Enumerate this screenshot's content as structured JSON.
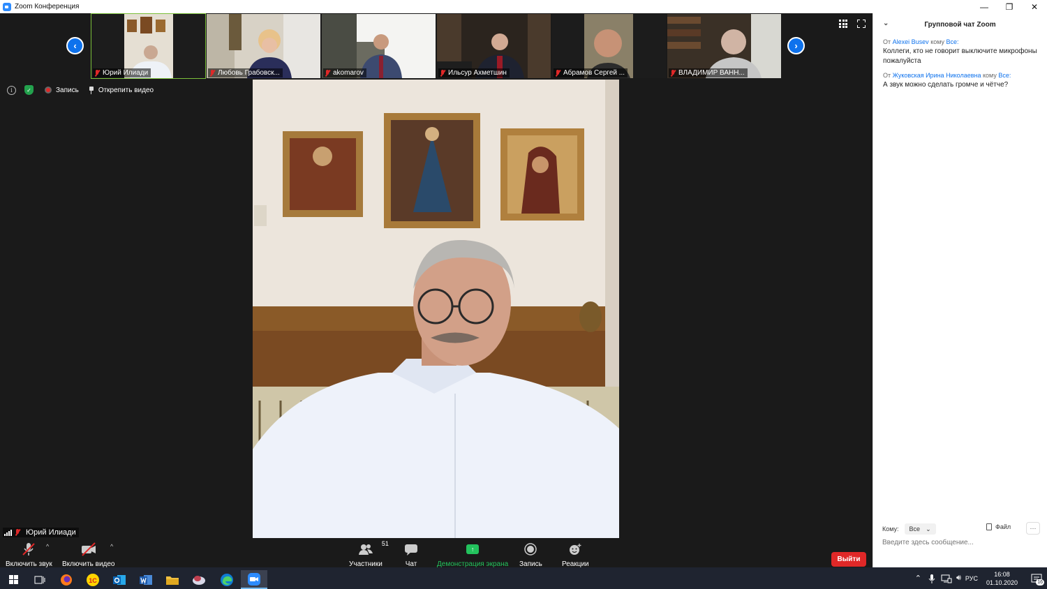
{
  "window": {
    "title": "Zoom Конференция",
    "minimize": "—",
    "restore": "❐",
    "close": "✕"
  },
  "thumbnails": [
    {
      "name": "Юрий Илиади",
      "active": true,
      "muted": true
    },
    {
      "name": "Любовь Грабовск...",
      "active": false,
      "muted": true
    },
    {
      "name": "akomarov",
      "active": false,
      "muted": true
    },
    {
      "name": "Ильсур Ахметшин",
      "active": false,
      "muted": true
    },
    {
      "name": "Абрамов Сергей ...",
      "active": false,
      "muted": true
    },
    {
      "name": "ВЛАДИМИР ВАНН...",
      "active": false,
      "muted": true
    }
  ],
  "status": {
    "info_icon": "i",
    "shield_icon": "✓",
    "recording": "Запись",
    "unpin": "Открепить видео"
  },
  "speaker": {
    "name": "Юрий Илиади"
  },
  "toolbar": {
    "unmute": "Включить звук",
    "start_video": "Включить видео",
    "participants": "Участники",
    "participants_count": "51",
    "chat": "Чат",
    "share_screen": "Демонстрация экрана",
    "record": "Запись",
    "reactions": "Реакции",
    "leave": "Выйти",
    "caret": "^",
    "share_arrow": "↑"
  },
  "chat": {
    "header": "Групповой чат Zoom",
    "collapse": "⌄",
    "messages": [
      {
        "from_prefix": "От",
        "from": "Alexei Busev",
        "to_prefix": "кому",
        "to": "Все:",
        "text": "Коллеги, кто не говорит выключите микрофоны пожалуйста"
      },
      {
        "from_prefix": "От",
        "from": "Жуковская Ирина Николаевна",
        "to_prefix": "кому",
        "to": "Все:",
        "text": "А звук можно сделать громче и чётче?"
      }
    ],
    "to_label": "Кому:",
    "to_value": "Все",
    "file": "Файл",
    "more": "···",
    "input_placeholder": "Введите здесь сообщение..."
  },
  "taskbar": {
    "lang": "РУС",
    "time": "16:08",
    "date": "01.10.2020",
    "notif_count": "16",
    "app_1c": "1С"
  },
  "colors": {
    "zoom_blue": "#0e72ed",
    "leave_red": "#e02828",
    "share_green": "#23c25d",
    "active_border": "#7bbf3a"
  }
}
